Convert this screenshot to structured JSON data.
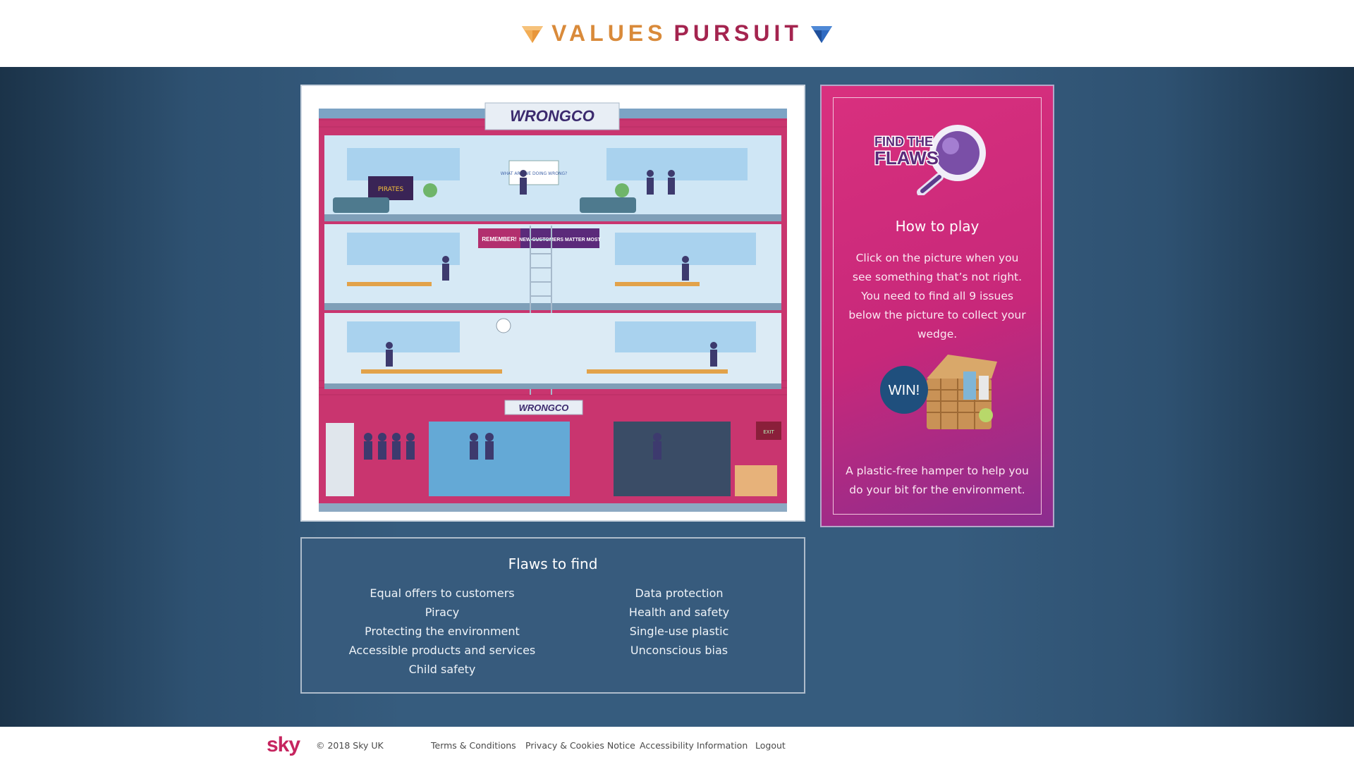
{
  "header": {
    "logo_word1": "VALUES",
    "logo_word2": "PURSUIT"
  },
  "picture": {
    "company_sign": "WRONGCO",
    "company_sign_small": "WRONGCO",
    "banner_1": "REMEMBER!",
    "banner_2": "NEW CUSTOMERS MATTER MOST",
    "poster": "PIRATES",
    "whiteboard": "WHAT ARE WE DOING WRONG?",
    "exit_sign": "EXIT"
  },
  "howto": {
    "badge_line1": "FIND THE",
    "badge_line2": "FLAWS",
    "title": "How to play",
    "body": "Click on the picture when you see something that’s not right. You need to find all 9 issues below the picture to collect your wedge.",
    "win_badge": "WIN!",
    "prize": "A plastic-free hamper to help you do your bit for the environment."
  },
  "flaws": {
    "title": "Flaws to find",
    "left": [
      "Equal offers to customers",
      "Piracy",
      "Protecting the environment",
      "Accessible products and services",
      "Child safety"
    ],
    "right": [
      "Data protection",
      "Health and safety",
      "Single-use plastic",
      "Unconscious bias"
    ]
  },
  "footer": {
    "brand": "sky",
    "copyright": "© 2018 Sky UK",
    "links": [
      "Terms & Conditions",
      "Privacy & Cookies Notice",
      "Accessibility Information",
      "Logout"
    ]
  },
  "colors": {
    "stage": "#365c7e",
    "card": "#d9307e",
    "logo_orange": "#d98a3a",
    "logo_red": "#a4244f",
    "brick": "#c9356f"
  }
}
